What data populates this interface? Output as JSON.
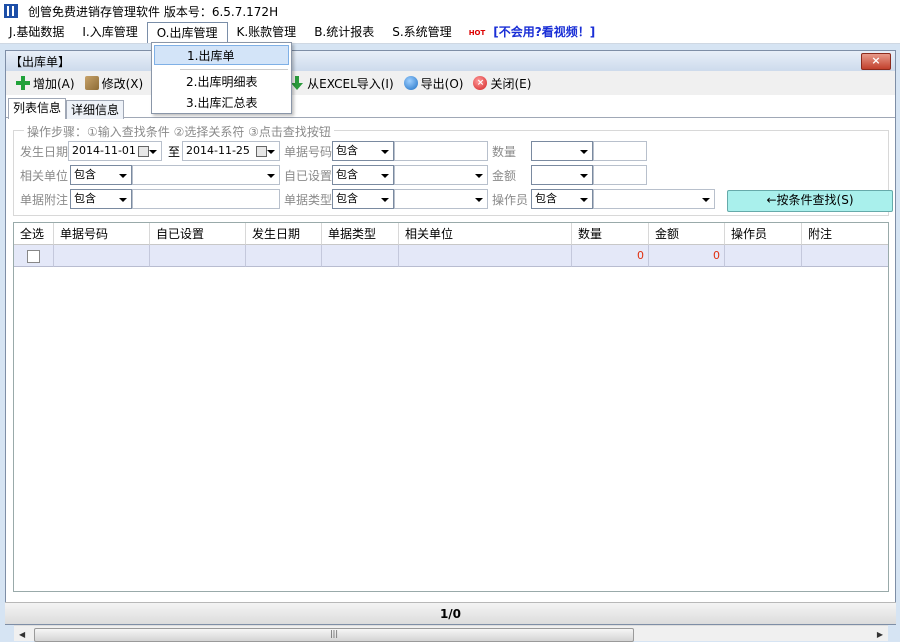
{
  "window": {
    "title": "创管免费进销存管理软件 版本号：6.5.7.172H"
  },
  "menubar": {
    "items": [
      {
        "label": "J.基础数据"
      },
      {
        "label": "I.入库管理"
      },
      {
        "label": "O.出库管理"
      },
      {
        "label": "K.账款管理"
      },
      {
        "label": "B.统计报表"
      },
      {
        "label": "S.系统管理"
      }
    ],
    "hot_badge": "HOT",
    "help_link": "[不会用?看视频！]"
  },
  "dropdown": {
    "items": [
      {
        "label": "1.出库单"
      },
      {
        "label": "2.出库明细表"
      },
      {
        "label": "3.出库汇总表"
      }
    ]
  },
  "inner_window": {
    "title": "【出库单】",
    "close": "×"
  },
  "toolbar": {
    "add": "增加(A)",
    "edit": "修改(X)",
    "import_excel": "从EXCEL导入(I)",
    "export": "导出(O)",
    "close": "关闭(E)"
  },
  "tabs": [
    {
      "label": "列表信息"
    },
    {
      "label": "详细信息"
    }
  ],
  "criteria": {
    "steps": "操作步骤：①输入查找条件 ②选择关系符 ③点击查找按钮",
    "date_label": "发生日期",
    "date_from": "2014-11-01",
    "date_to_label": "至",
    "date_to": "2014-11-25",
    "doc_no_label": "单据号码",
    "qty_label": "数量",
    "unit_label": "相关单位",
    "custom_label": "自已设置",
    "amount_label": "金额",
    "note_label": "单据附注",
    "doc_type_label": "单据类型",
    "operator_label": "操作员",
    "contains": "包含",
    "search_button": "←按条件查找(S)"
  },
  "grid": {
    "columns": [
      "全选",
      "单据号码",
      "自已设置",
      "发生日期",
      "单据类型",
      "相关单位",
      "数量",
      "金额",
      "操作员",
      "附注"
    ],
    "rows": [
      {
        "qty": "0",
        "amount": "0"
      }
    ]
  },
  "status": {
    "page": "1/0"
  },
  "colors": {
    "accent_header": "#d6e4f3",
    "row_bg": "#e4e8f8",
    "number_red": "#e03010",
    "search_btn": "#a9f0ec"
  }
}
